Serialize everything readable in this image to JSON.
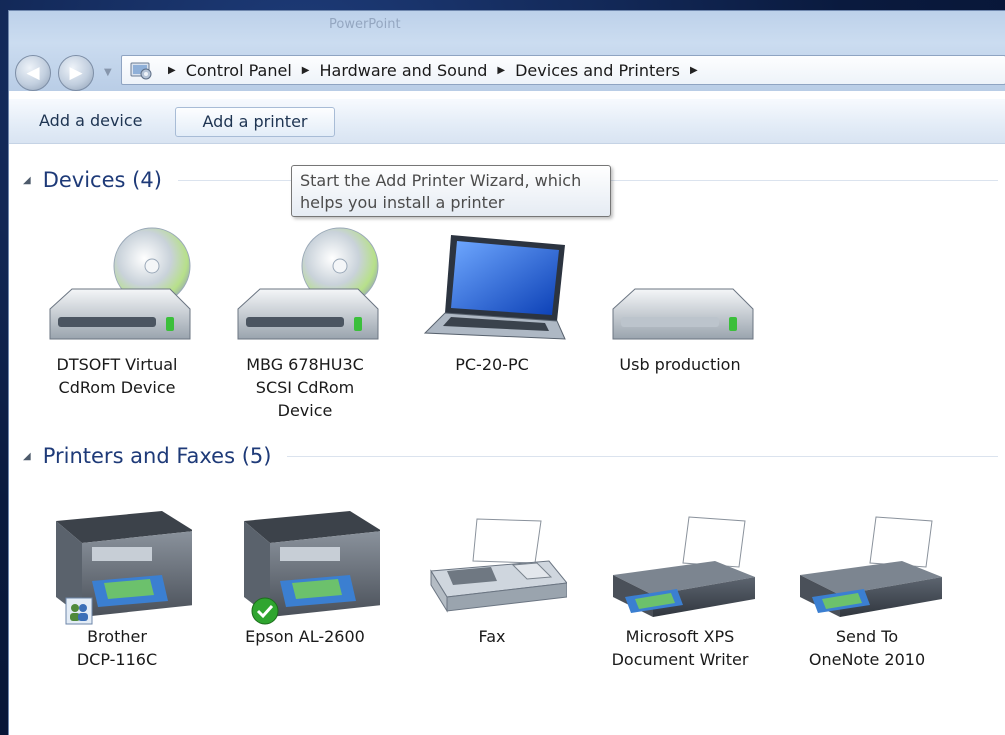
{
  "window": {
    "title_ghost": "PowerPoint"
  },
  "navigation": {
    "back_glyph": "◀",
    "forward_glyph": "▶",
    "breadcrumb": [
      "Control Panel",
      "Hardware and Sound",
      "Devices and Printers"
    ]
  },
  "toolbar": {
    "add_device": "Add a device",
    "add_printer": "Add a printer"
  },
  "tooltip": {
    "line1": "Start the Add Printer Wizard, which",
    "line2": "helps you install a printer"
  },
  "devices": {
    "title": "Devices (4)",
    "items": [
      {
        "lines": [
          "DTSOFT Virtual",
          "CdRom Device"
        ],
        "icon": "cdrom-drive-icon"
      },
      {
        "lines": [
          "MBG 678HU3C",
          "SCSI CdRom",
          "Device"
        ],
        "icon": "cdrom-drive-icon"
      },
      {
        "lines": [
          "PC-20-PC"
        ],
        "icon": "laptop-icon"
      },
      {
        "lines": [
          "Usb production"
        ],
        "icon": "drive-icon"
      }
    ]
  },
  "printers": {
    "title": "Printers and Faxes (5)",
    "items": [
      {
        "lines": [
          "Brother",
          "DCP-116C"
        ],
        "icon": "multifunction-printer-icon",
        "badge": "shared-users-badge-icon"
      },
      {
        "lines": [
          "Epson AL-2600"
        ],
        "icon": "multifunction-printer-icon",
        "badge": "default-checkmark-badge-icon"
      },
      {
        "lines": [
          "Fax"
        ],
        "icon": "fax-icon"
      },
      {
        "lines": [
          "Microsoft XPS",
          "Document Writer"
        ],
        "icon": "printer-icon"
      },
      {
        "lines": [
          "Send To",
          "OneNote 2010"
        ],
        "icon": "printer-icon"
      }
    ]
  },
  "colors": {
    "section_title": "#1e3a78",
    "toolbar_text": "#1e3452",
    "desktop": "#0a1a3e"
  }
}
